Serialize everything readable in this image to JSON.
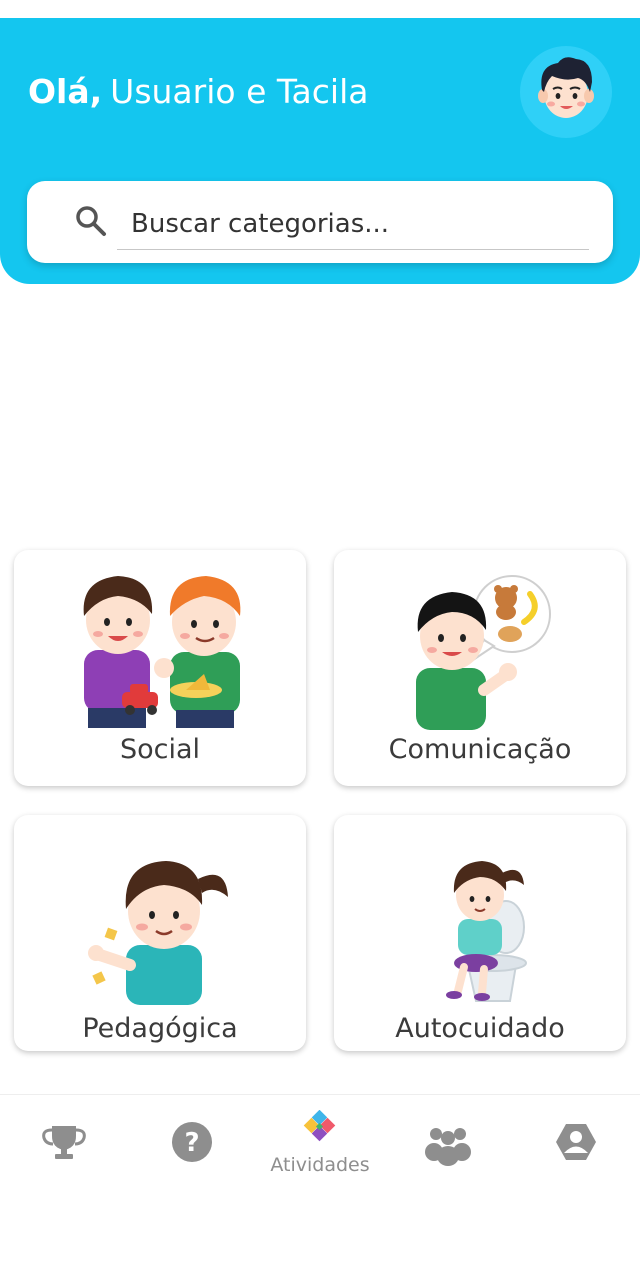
{
  "header": {
    "greeting_prefix": "Olá,",
    "user_name": "Usuario e Tacila",
    "background_color": "#14c6ef"
  },
  "search": {
    "placeholder": "Buscar categorias...",
    "value": ""
  },
  "categories": [
    {
      "label": "Social",
      "icon": "two-boys-playing-illustration"
    },
    {
      "label": "Comunicação",
      "icon": "boy-talking-about-toys-illustration"
    },
    {
      "label": "Pedagógica",
      "icon": "girl-with-paper-illustration"
    },
    {
      "label": "Autocuidado",
      "icon": "girl-on-toilet-illustration"
    }
  ],
  "bottom_nav": {
    "items": [
      {
        "name": "trophy-icon",
        "label": ""
      },
      {
        "name": "help-icon",
        "label": ""
      },
      {
        "name": "activities-puzzle-icon",
        "label": "Atividades",
        "active": true
      },
      {
        "name": "group-icon",
        "label": ""
      },
      {
        "name": "profile-icon",
        "label": ""
      }
    ],
    "inactive_color": "#8e8e8e"
  }
}
